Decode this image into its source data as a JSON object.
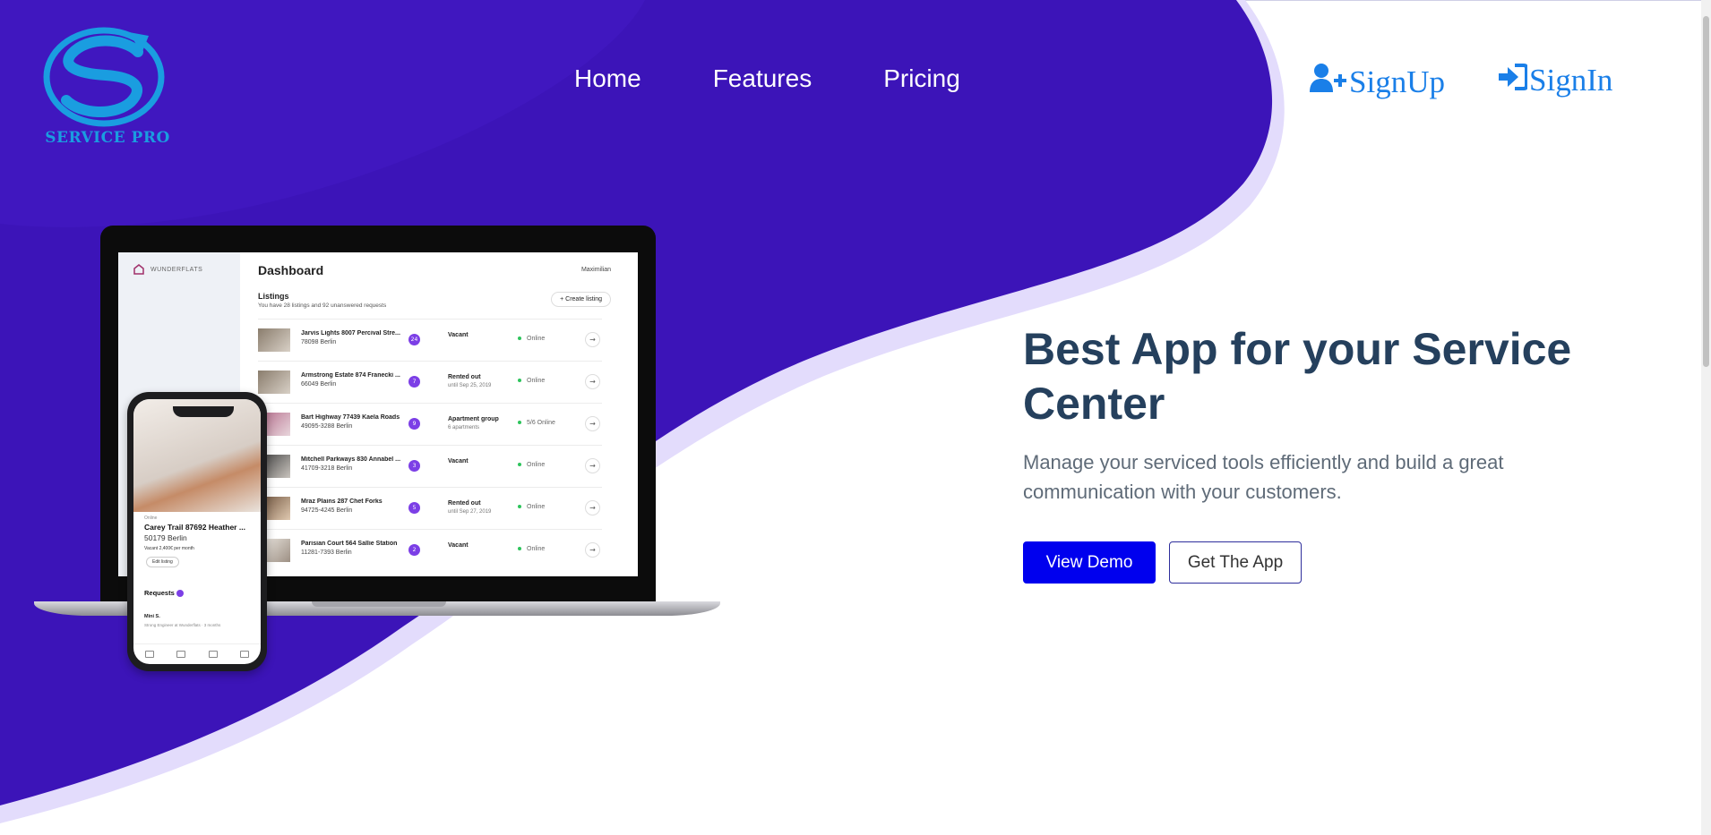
{
  "brand": {
    "name": "SERVICE PRO",
    "logo_color": "#1a9de0"
  },
  "nav": {
    "items": [
      {
        "label": "Home"
      },
      {
        "label": "Features"
      },
      {
        "label": "Pricing"
      }
    ]
  },
  "auth": {
    "signup_label": "SignUp",
    "signin_label": "SignIn",
    "signup_icon": "user-plus-icon",
    "signin_icon": "sign-in-icon"
  },
  "hero": {
    "title": "Best App for your Service Center",
    "subtitle": "Manage your serviced tools efficiently and build a great communication with your customers.",
    "primary_button": "View Demo",
    "secondary_button": "Get The App"
  },
  "colors": {
    "hero_purple": "#3c14b8",
    "accent_lavender": "#e3dcfc",
    "primary_button": "#0000ee",
    "title_color": "#25405d",
    "link_blue": "#1a7fe8"
  },
  "mockup": {
    "laptop": {
      "brand": "WUNDERFLATS",
      "title": "Dashboard",
      "user": "Maximilian",
      "listings_heading": "Listings",
      "listings_sub": "You have 28 listings and 92 unanswered requests",
      "create_button": "+ Create listing",
      "rows": [
        {
          "address": "Jarvis Lights 8007 Percival Stre...",
          "city": "78098 Berlin",
          "badge": "24",
          "status": "Vacant",
          "status_sub": "",
          "online": "Online"
        },
        {
          "address": "Armstrong Estate 874 Franecki ...",
          "city": "66049 Berlin",
          "badge": "7",
          "status": "Rented out",
          "status_sub": "until Sep 25, 2019",
          "online": "Online"
        },
        {
          "address": "Bart Highway 77439 Kaela Roads",
          "city": "49095-3288 Berlin",
          "badge": "9",
          "status": "Apartment group",
          "status_sub": "6 apartments",
          "online": "5/6 Online"
        },
        {
          "address": "Mitchell Parkways 830 Annabel ...",
          "city": "41709-3218 Berlin",
          "badge": "3",
          "status": "Vacant",
          "status_sub": "",
          "online": "Online"
        },
        {
          "address": "Mraz Plains 287 Chet Forks",
          "city": "94725-4245 Berlin",
          "badge": "5",
          "status": "Rented out",
          "status_sub": "until Sep 27, 2019",
          "online": "Online"
        },
        {
          "address": "Parisian Court 564 Sallie Station",
          "city": "11281-7393 Berlin",
          "badge": "2",
          "status": "Vacant",
          "status_sub": "",
          "online": "Online"
        }
      ]
    },
    "phone": {
      "status": "Online",
      "title": "Carey Trail 87692 Heather ...",
      "city": "50179 Berlin",
      "meta": "Vacant  2,400€ per month",
      "edit_button": "Edit listing",
      "requests_heading": "Requests",
      "request_name": "Mini S.",
      "request_sub": "Strong Engineer at Wunderflats · 3 months"
    }
  }
}
